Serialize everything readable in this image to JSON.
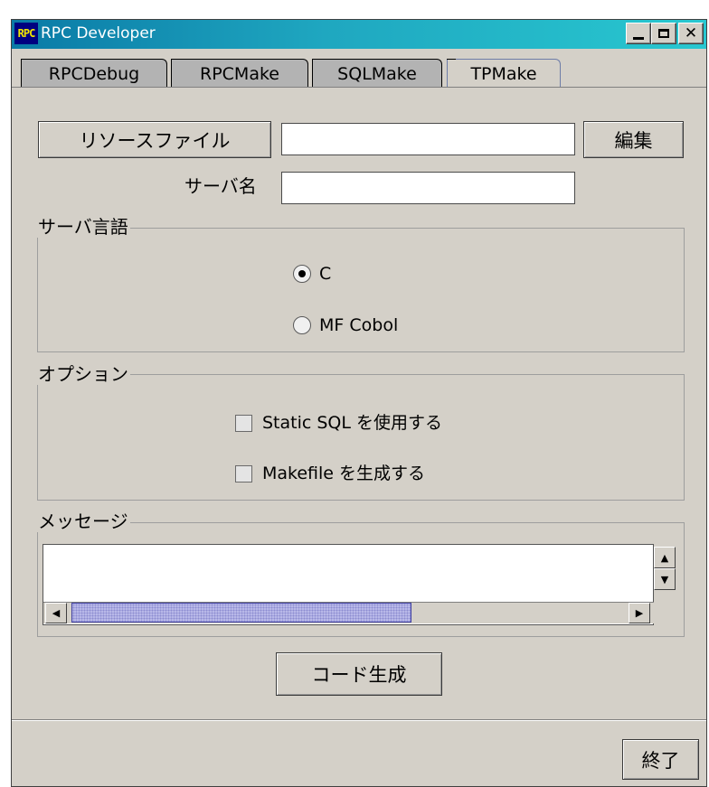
{
  "window": {
    "app_icon_text": "RPC",
    "title": "RPC Developer",
    "controls": {
      "minimize": "minimize-icon",
      "maximize": "maximize-icon",
      "close": "close-icon"
    }
  },
  "tabs": [
    {
      "label": "RPCDebug",
      "active": false
    },
    {
      "label": "RPCMake",
      "active": false
    },
    {
      "label": "SQLMake",
      "active": false
    },
    {
      "label": "TPMake",
      "active": true
    }
  ],
  "form": {
    "resource_file_button": "リソースファイル",
    "resource_file_value": "",
    "edit_button": "編集",
    "server_name_label": "サーバ名",
    "server_name_value": ""
  },
  "server_language": {
    "legend": "サーバ言語",
    "options": [
      {
        "label": "C",
        "selected": true
      },
      {
        "label": "MF Cobol",
        "selected": false
      }
    ]
  },
  "options": {
    "legend": "オプション",
    "items": [
      {
        "label": "Static SQL を使用する",
        "checked": false
      },
      {
        "label": "Makefile を生成する",
        "checked": false
      }
    ]
  },
  "messages": {
    "legend": "メッセージ",
    "content": "",
    "horizontal_scroll_fraction": 0.61
  },
  "generate_button": "コード生成",
  "exit_button": "終了",
  "colors": {
    "title_gradient_start": "#0a7aa6",
    "title_gradient_end": "#28c7d0",
    "face": "#d4d0c8",
    "scroll_thumb": "#b8b8e8"
  }
}
